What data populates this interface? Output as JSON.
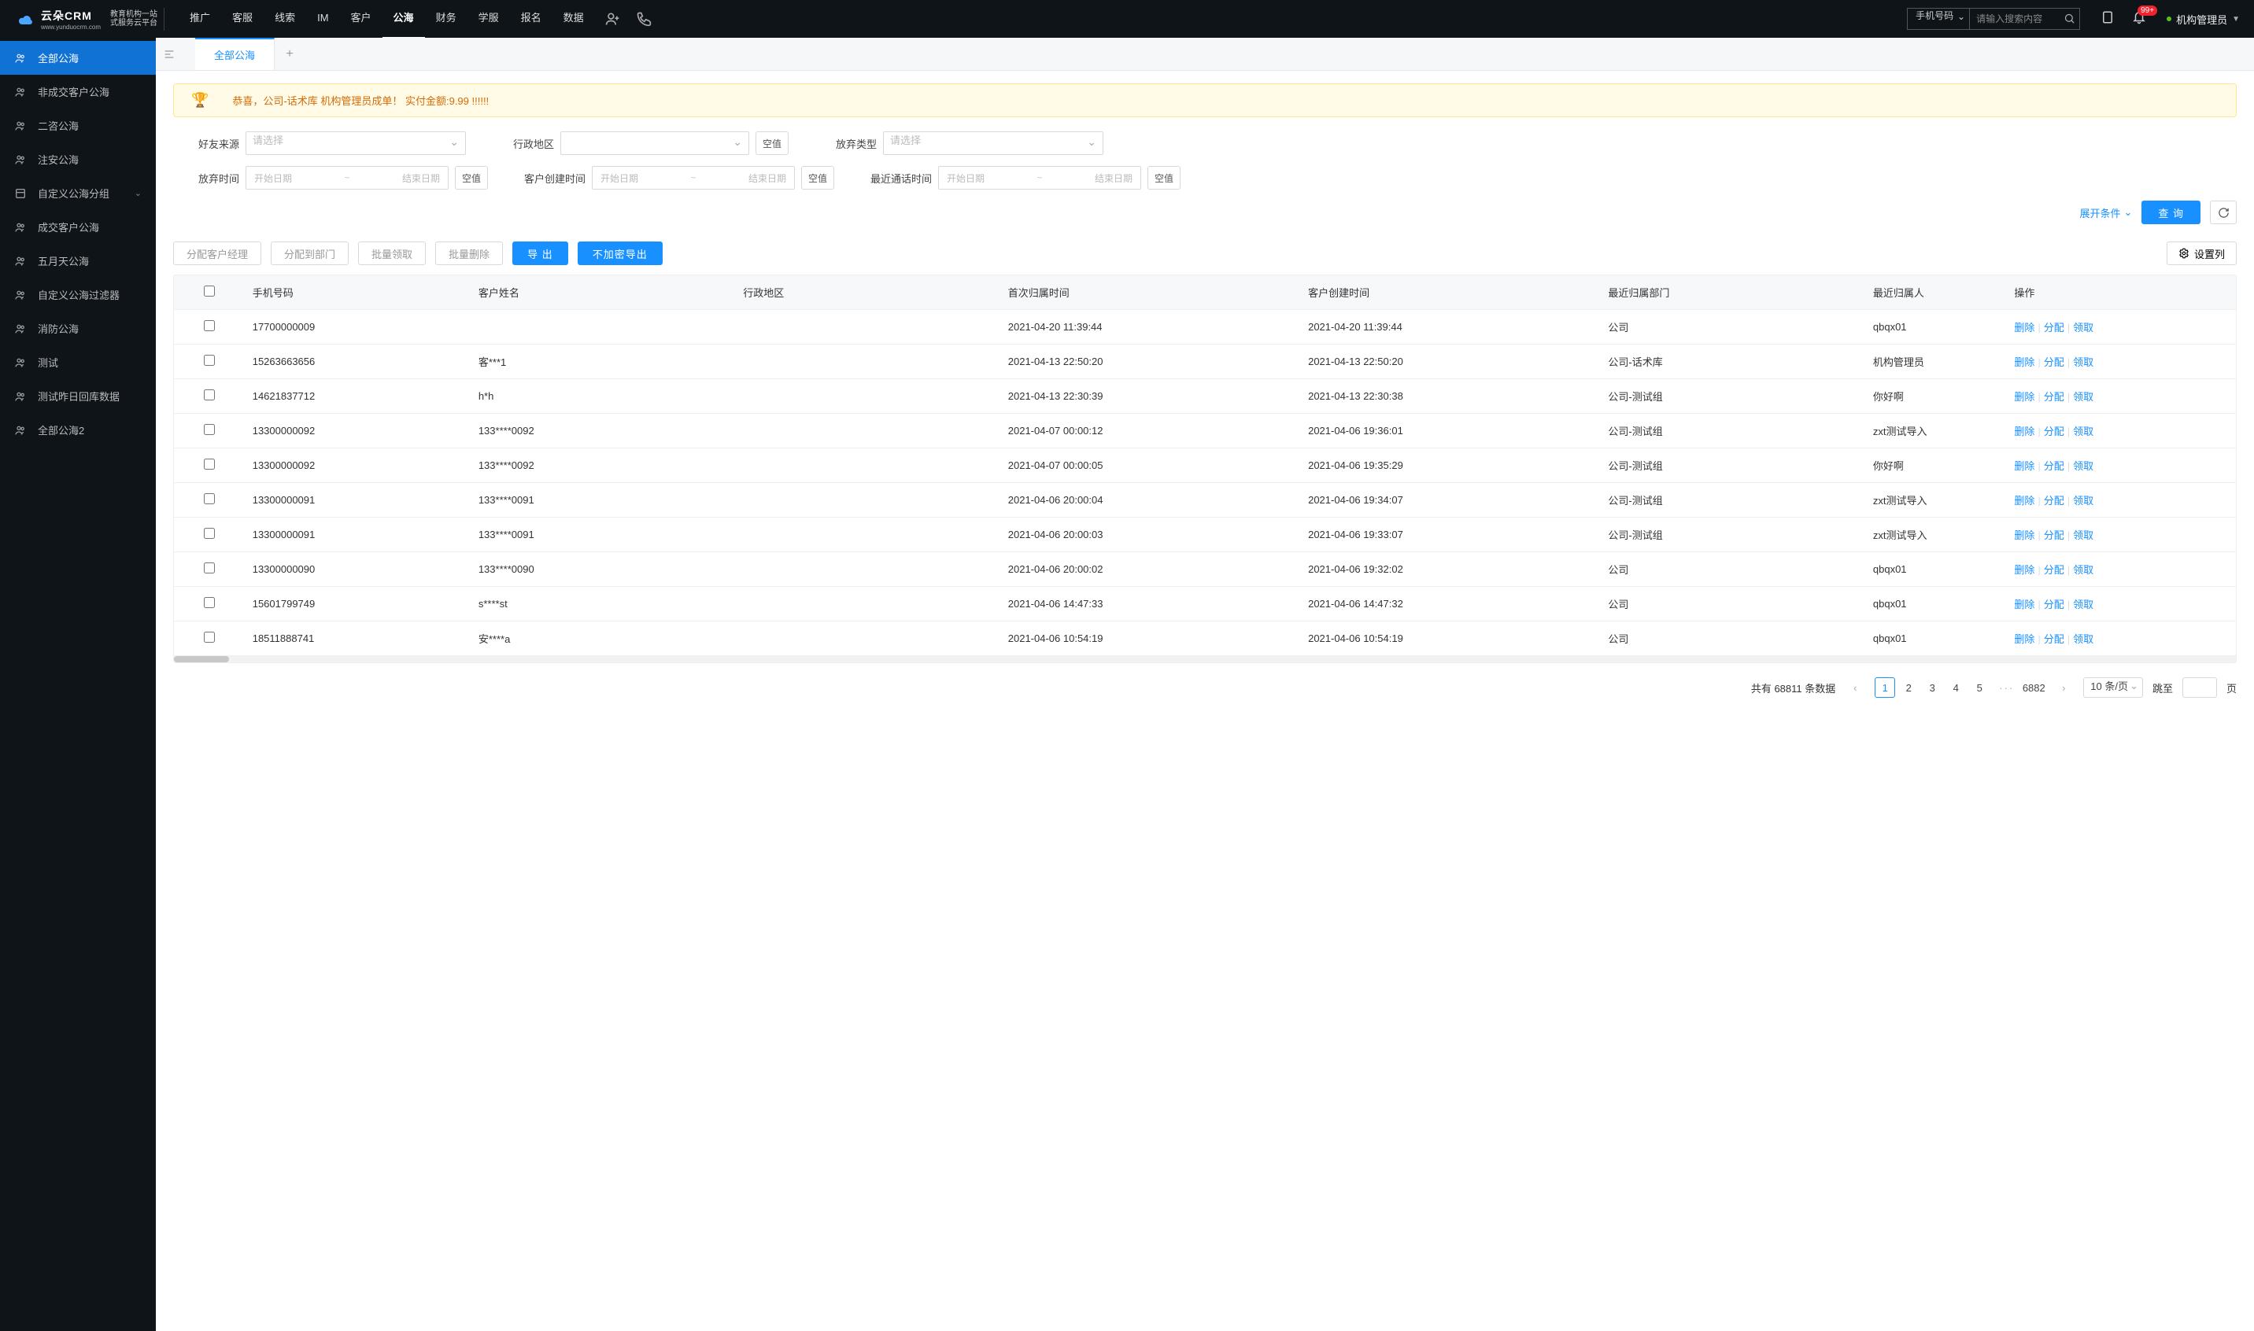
{
  "logo": {
    "title": "云朵CRM",
    "domain": "www.yunduocrm.com",
    "tag1": "教育机构一站",
    "tag2": "式服务云平台"
  },
  "top_nav": [
    "推广",
    "客服",
    "线索",
    "IM",
    "客户",
    "公海",
    "财务",
    "学服",
    "报名",
    "数据"
  ],
  "top_nav_active_index": 5,
  "search": {
    "type": "手机号码",
    "placeholder": "请输入搜索内容"
  },
  "notif_badge": "99+",
  "user_name": "机构管理员",
  "sidebar": {
    "items": [
      {
        "label": "全部公海",
        "icon": "users-icon",
        "active": true
      },
      {
        "label": "非成交客户公海",
        "icon": "users-icon"
      },
      {
        "label": "二咨公海",
        "icon": "users-icon"
      },
      {
        "label": "注安公海",
        "icon": "users-icon"
      },
      {
        "label": "自定义公海分组",
        "icon": "layers-icon",
        "chevron": true
      },
      {
        "label": "成交客户公海",
        "icon": "users-icon"
      },
      {
        "label": "五月天公海",
        "icon": "users-icon"
      },
      {
        "label": "自定义公海过滤器",
        "icon": "users-icon"
      },
      {
        "label": "消防公海",
        "icon": "users-icon"
      },
      {
        "label": "测试",
        "icon": "users-icon"
      },
      {
        "label": "测试昨日回库数据",
        "icon": "users-icon"
      },
      {
        "label": "全部公海2",
        "icon": "users-icon"
      }
    ]
  },
  "tab": {
    "label": "全部公海"
  },
  "banner": "恭喜，公司-话术库 机构管理员成单！ 实付金额:9.99 !!!!!!",
  "filters": {
    "friend_src": {
      "label": "好友来源",
      "placeholder": "请选择"
    },
    "region": {
      "label": "行政地区",
      "empty_btn": "空值"
    },
    "abandon_type": {
      "label": "放弃类型",
      "placeholder": "请选择"
    },
    "abandon_time": {
      "label": "放弃时间",
      "start": "开始日期",
      "end": "结束日期",
      "empty": "空值"
    },
    "create_time": {
      "label": "客户创建时间",
      "start": "开始日期",
      "end": "结束日期",
      "empty": "空值"
    },
    "last_call": {
      "label": "最近通话时间",
      "start": "开始日期",
      "end": "结束日期",
      "empty": "空值"
    }
  },
  "expand": "展开条件",
  "query_btn": "查 询",
  "toolbar": {
    "assign_mgr": "分配客户经理",
    "assign_dept": "分配到部门",
    "batch_claim": "批量领取",
    "batch_delete": "批量删除",
    "export": "导 出",
    "export_plain": "不加密导出",
    "columns": "设置列"
  },
  "table": {
    "headers": [
      "手机号码",
      "客户姓名",
      "行政地区",
      "首次归属时间",
      "客户创建时间",
      "最近归属部门",
      "最近归属人",
      "操作"
    ],
    "ops": {
      "del": "删除",
      "assign": "分配",
      "claim": "领取"
    },
    "rows": [
      {
        "phone": "17700000009",
        "name": "",
        "region": "",
        "first": "2021-04-20 11:39:44",
        "create": "2021-04-20 11:39:44",
        "dept": "公司",
        "owner": "qbqx01"
      },
      {
        "phone": "15263663656",
        "name": "客***1",
        "region": "",
        "first": "2021-04-13 22:50:20",
        "create": "2021-04-13 22:50:20",
        "dept": "公司-话术库",
        "owner": "机构管理员"
      },
      {
        "phone": "14621837712",
        "name": "h*h",
        "region": "",
        "first": "2021-04-13 22:30:39",
        "create": "2021-04-13 22:30:38",
        "dept": "公司-测试组",
        "owner": "你好啊"
      },
      {
        "phone": "13300000092",
        "name": "133****0092",
        "region": "",
        "first": "2021-04-07 00:00:12",
        "create": "2021-04-06 19:36:01",
        "dept": "公司-测试组",
        "owner": "zxt测试导入"
      },
      {
        "phone": "13300000092",
        "name": "133****0092",
        "region": "",
        "first": "2021-04-07 00:00:05",
        "create": "2021-04-06 19:35:29",
        "dept": "公司-测试组",
        "owner": "你好啊"
      },
      {
        "phone": "13300000091",
        "name": "133****0091",
        "region": "",
        "first": "2021-04-06 20:00:04",
        "create": "2021-04-06 19:34:07",
        "dept": "公司-测试组",
        "owner": "zxt测试导入"
      },
      {
        "phone": "13300000091",
        "name": "133****0091",
        "region": "",
        "first": "2021-04-06 20:00:03",
        "create": "2021-04-06 19:33:07",
        "dept": "公司-测试组",
        "owner": "zxt测试导入"
      },
      {
        "phone": "13300000090",
        "name": "133****0090",
        "region": "",
        "first": "2021-04-06 20:00:02",
        "create": "2021-04-06 19:32:02",
        "dept": "公司",
        "owner": "qbqx01"
      },
      {
        "phone": "15601799749",
        "name": "s****st",
        "region": "",
        "first": "2021-04-06 14:47:33",
        "create": "2021-04-06 14:47:32",
        "dept": "公司",
        "owner": "qbqx01"
      },
      {
        "phone": "18511888741",
        "name": "安****a",
        "region": "",
        "first": "2021-04-06 10:54:19",
        "create": "2021-04-06 10:54:19",
        "dept": "公司",
        "owner": "qbqx01"
      }
    ]
  },
  "pagination": {
    "total_prefix": "共有",
    "total": "68811",
    "total_suffix": "条数据",
    "pages": [
      "1",
      "2",
      "3",
      "4",
      "5"
    ],
    "last": "6882",
    "ellipsis": "···",
    "size": "10 条/页",
    "goto_prefix": "跳至",
    "goto_suffix": "页"
  }
}
